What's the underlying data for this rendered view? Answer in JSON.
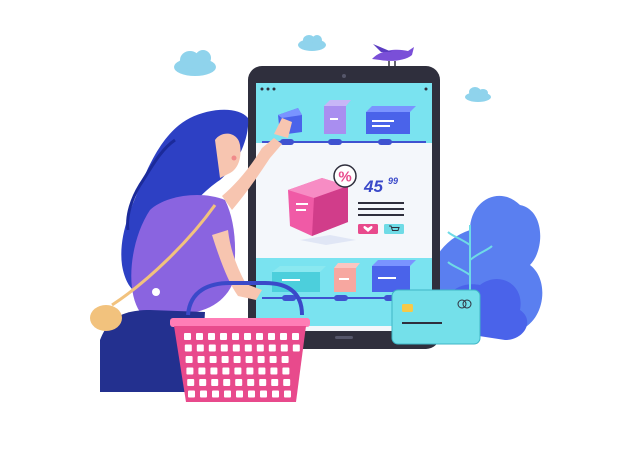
{
  "product": {
    "price_main": "45",
    "price_cents": "99",
    "discount_symbol": "%"
  },
  "icons": {
    "heart": "heart-icon",
    "cart": "cart-icon",
    "percent": "percent-badge",
    "chip": "card-chip-icon"
  },
  "colors": {
    "tablet": "#2f2f3d",
    "screen": "#f4f7fb",
    "top_strip": "#7ae3f0",
    "box_blue": "#4a63ea",
    "box_pink": "#f05aa6",
    "box_peach": "#f7a7a0",
    "box_cyan": "#6fdbe6",
    "basket": "#e84a8c",
    "hair": "#2d40c4",
    "shirt": "#8a64e0",
    "jeans": "#23308f",
    "card": "#74e0ea",
    "bush": "#5a7ff0",
    "price_text": "#3a49c9"
  }
}
